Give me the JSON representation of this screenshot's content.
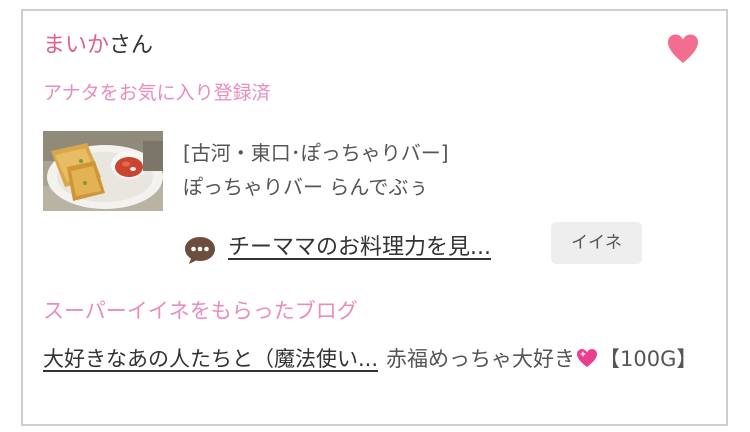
{
  "user": {
    "name": "まいか",
    "suffix": "さん"
  },
  "favorite": {
    "status": "アナタをお気に入り登録済",
    "heart_icon": "heart-icon",
    "heart_color": "#f26d8f"
  },
  "shop": {
    "area": "[古河・東口･ぽっちゃりバー]",
    "name": "ぽっちゃりバー らんでぶぅ",
    "thumbnail_icon": "food-photo"
  },
  "post": {
    "icon": "speech-bubble-icon",
    "link_text": "チーママのお料理力を見...",
    "iine_label": "イイネ"
  },
  "super_iine": {
    "heading": "スーパーイイネをもらったブログ",
    "blog_link_text": "大好きなあの人たちと（魔法使い...",
    "comment_text": "赤福めっちゃ大好き",
    "comment_suffix": "【100G】",
    "emoji_icon": "sparkling-heart-icon"
  },
  "colors": {
    "accent_pink": "#e0608f",
    "label_pink": "#e98cbf",
    "text_dark": "#333333",
    "text_gray": "#555555",
    "border": "#cfcfcf",
    "button_bg": "#eeeeee"
  }
}
